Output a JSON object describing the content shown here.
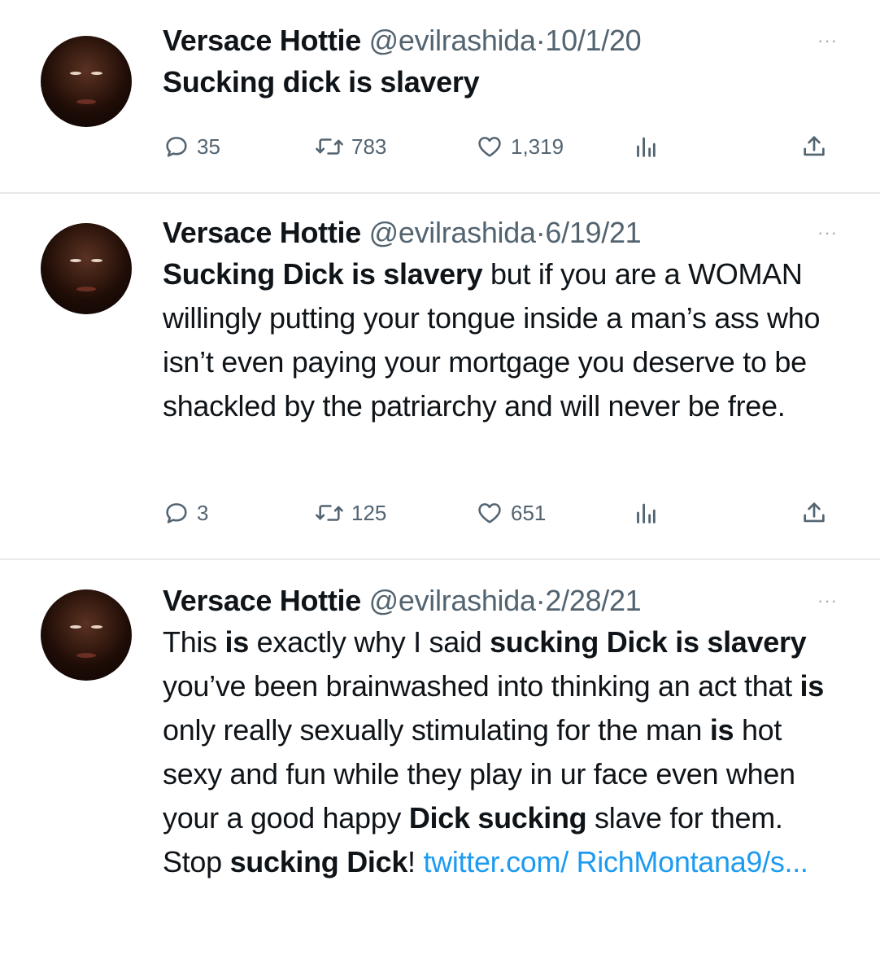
{
  "tweets": [
    {
      "name": "Versace Hottie",
      "handle": "@evilrashida",
      "separator": "·",
      "date": "10/1/20",
      "more": "···",
      "body_parts": [
        {
          "text": "Sucking dick is slavery",
          "bold": true
        }
      ],
      "replies": "35",
      "retweets": "783",
      "likes": "1,319"
    },
    {
      "name": "Versace Hottie",
      "handle": "@evilrashida",
      "separator": "·",
      "date": "6/19/21",
      "more": "···",
      "body_parts": [
        {
          "text": "Sucking Dick is slavery",
          "bold": true
        },
        {
          "text": " but if you are a WOMAN willingly putting your tongue inside a man’s ass who isn’t even paying your mortgage you deserve to be shackled by the patriarchy and will never be free."
        }
      ],
      "replies": "3",
      "retweets": "125",
      "likes": "651"
    },
    {
      "name": "Versace Hottie",
      "handle": "@evilrashida",
      "separator": "·",
      "date": "2/28/21",
      "more": "···",
      "body_parts": [
        {
          "text": "This "
        },
        {
          "text": "is",
          "bold": true
        },
        {
          "text": " exactly why I said "
        },
        {
          "text": "sucking Dick is slavery",
          "bold": true
        },
        {
          "text": " you’ve been brainwashed into thinking an act that "
        },
        {
          "text": "is",
          "bold": true
        },
        {
          "text": " only really sexually stimulating for the man "
        },
        {
          "text": "is",
          "bold": true
        },
        {
          "text": " hot sexy and fun while they play in ur face even when your a good happy "
        },
        {
          "text": "Dick sucking",
          "bold": true
        },
        {
          "text": " slave for them. Stop "
        },
        {
          "text": "sucking Dick",
          "bold": true
        },
        {
          "text": "! "
        },
        {
          "text": "twitter.com/ RichMontana9/s...",
          "link": true
        }
      ]
    }
  ],
  "icons": {
    "reply": "reply-icon",
    "retweet": "retweet-icon",
    "like": "like-icon",
    "views": "views-icon",
    "share": "share-icon"
  },
  "colors": {
    "text": "#0f1419",
    "secondary": "#536471",
    "link": "#1d9bf0",
    "divider": "#e6e8ea"
  }
}
